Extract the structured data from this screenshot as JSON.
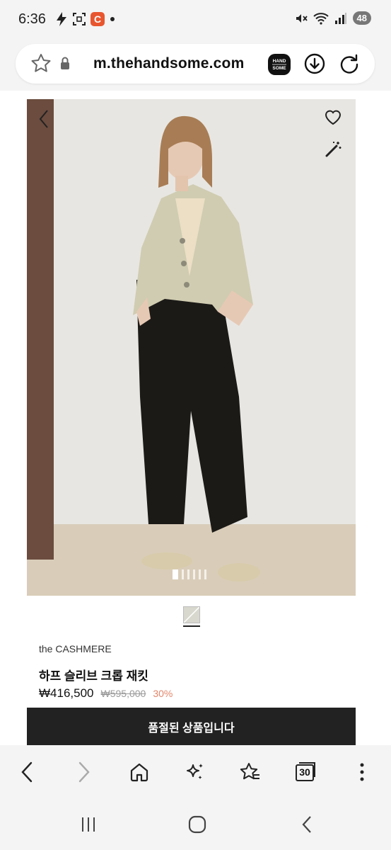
{
  "status_bar": {
    "time": "6:36",
    "battery": "48",
    "icons_left": [
      "flash-icon",
      "screenshot-icon",
      "c-app-icon",
      "dot-icon"
    ],
    "icons_right": [
      "mute-icon",
      "wifi-icon",
      "signal-icon",
      "battery-icon"
    ],
    "c_badge": "C"
  },
  "url_bar": {
    "url": "m.thehandsome.com",
    "site_badge": "HAND SOME"
  },
  "product": {
    "brand": "the CASHMERE",
    "name": "하프 슬리브 크롭 재킷",
    "price": "₩416,500",
    "original_price": "₩595,000",
    "discount": "30%",
    "soldout_label": "품절된 상품입니다",
    "image_count": 6,
    "active_image": 1
  },
  "toolbar": {
    "tabs_count": "30"
  },
  "colors": {
    "accent_discount": "#e2876b",
    "button_dark": "#222222",
    "c_badge": "#e8562f"
  }
}
